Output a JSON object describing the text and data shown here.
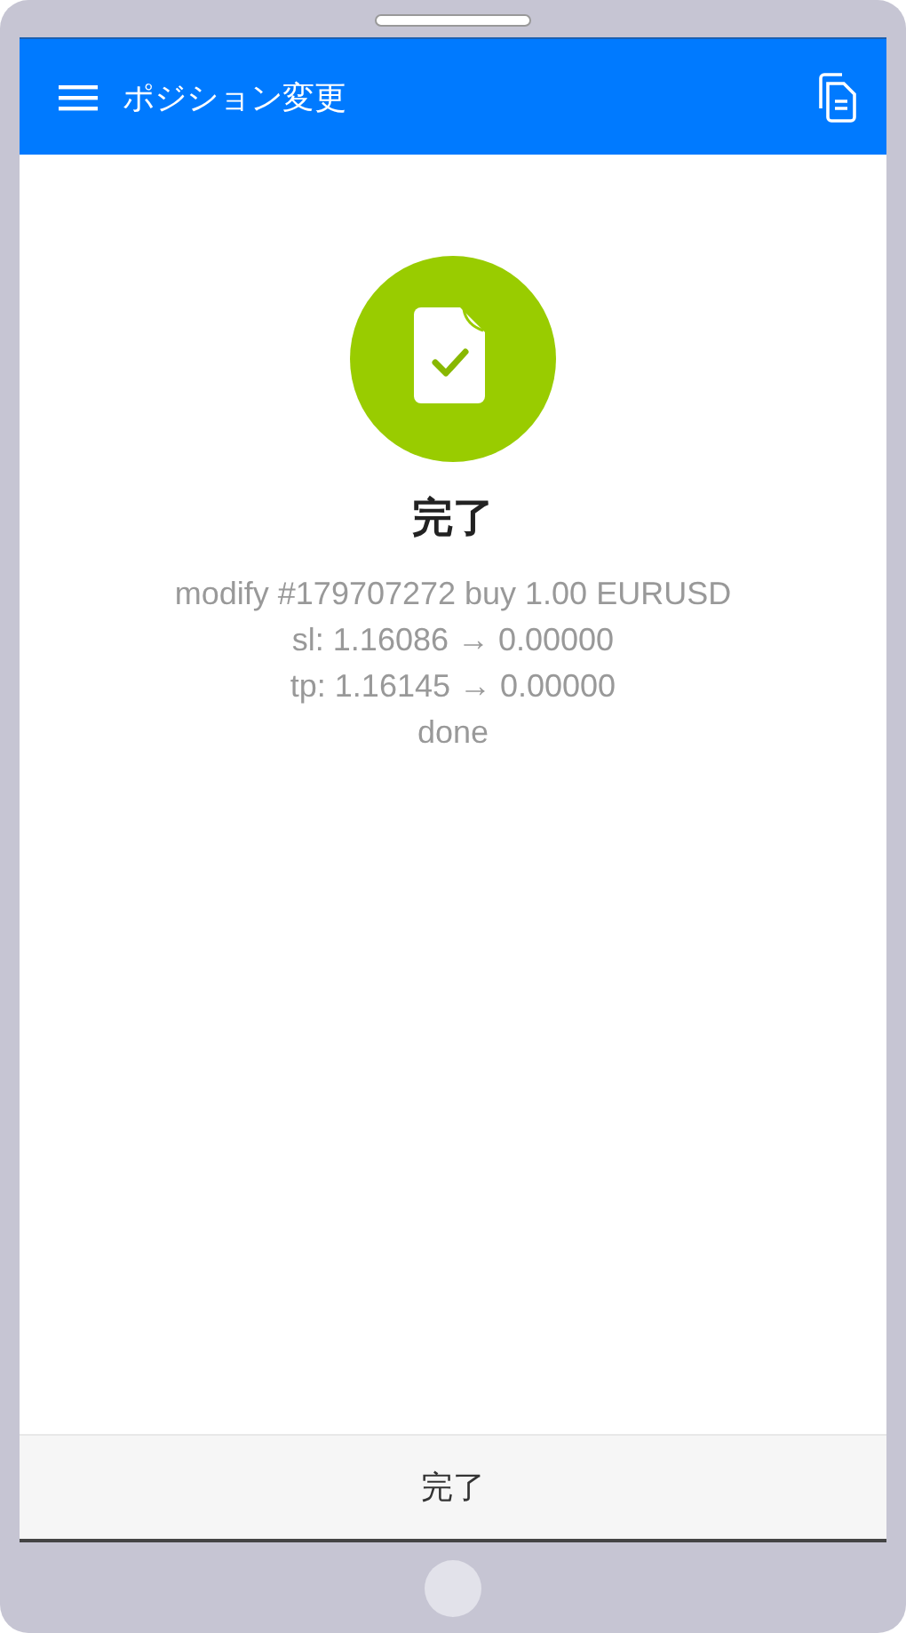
{
  "app_bar": {
    "title": "ポジション変更"
  },
  "result": {
    "heading": "完了",
    "message_lines": [
      "modify #179707272 buy 1.00 EURUSD",
      "sl: 1.16086 → 0.00000",
      "tp: 1.16145 → 0.00000",
      "done"
    ]
  },
  "footer_button": {
    "label": "完了"
  }
}
